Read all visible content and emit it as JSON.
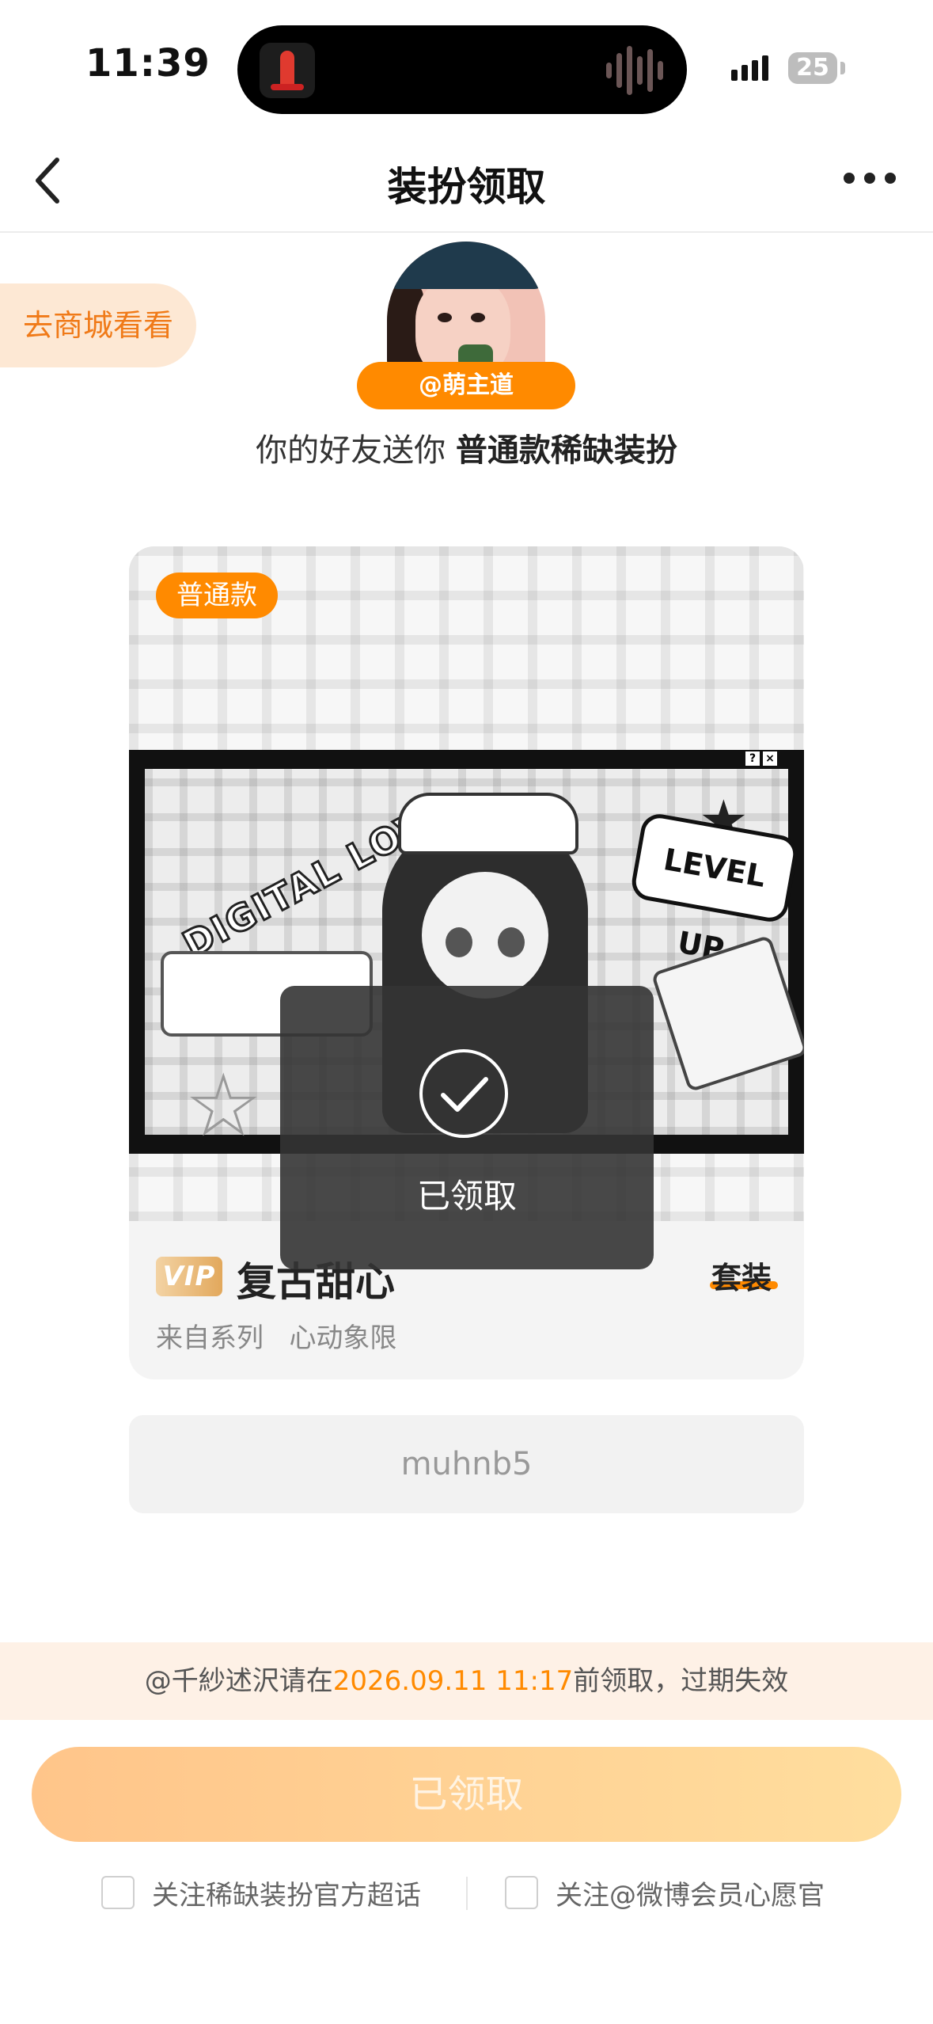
{
  "status_bar": {
    "time": "11:39",
    "battery": "25"
  },
  "nav": {
    "title": "装扮领取"
  },
  "shop_link": "去商城看看",
  "sender": {
    "username": "@萌主道"
  },
  "gift_message": {
    "prefix": "你的好友送你 ",
    "item": "普通款稀缺装扮"
  },
  "card": {
    "badge": "普通款",
    "art_text": {
      "love": "DIGITAL LOVE",
      "level_up": "LEVEL UP"
    },
    "vip_label": "VIP",
    "name": "复古甜心",
    "type": "套装",
    "series_label": "来自系列",
    "series_name": "心动象限"
  },
  "toast": {
    "text": "已领取"
  },
  "code": "muhnb5",
  "notice": {
    "prefix": "@千紗述沢请在",
    "deadline": "2026.09.11 11:17",
    "suffix": "前领取，过期失效"
  },
  "claim_button": "已领取",
  "follow_options": [
    {
      "label": "关注稀缺装扮官方超话"
    },
    {
      "label": "关注@微博会员心愿官"
    }
  ],
  "colors": {
    "accent": "#ff8a00",
    "notice_bg": "#fef1e6"
  }
}
